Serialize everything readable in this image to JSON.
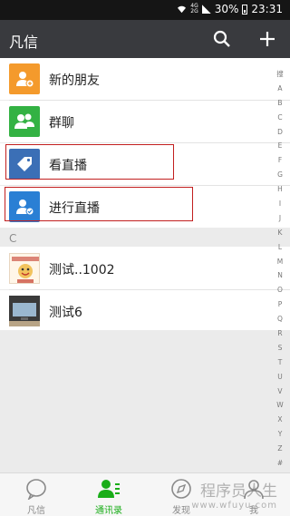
{
  "status": {
    "signal_top": "4G",
    "signal_bottom": "2G",
    "battery": "30%",
    "time": "23:31"
  },
  "header": {
    "title": "凡信",
    "search_icon": "search-icon",
    "add_icon": "plus-icon"
  },
  "menu": [
    {
      "label": "新的朋友",
      "icon": "new-friend-icon",
      "color": "#f49a2c"
    },
    {
      "label": "群聊",
      "icon": "group-chat-icon",
      "color": "#33b243"
    },
    {
      "label": "看直播",
      "icon": "tag-icon",
      "color": "#3b6fb6"
    },
    {
      "label": "进行直播",
      "icon": "start-live-icon",
      "color": "#2a7fd4"
    }
  ],
  "section_letter": "C",
  "contacts": [
    {
      "name": "测试..1002"
    },
    {
      "name": "测试6"
    }
  ],
  "alphabet_index": [
    "搜",
    "A",
    "B",
    "C",
    "D",
    "E",
    "F",
    "G",
    "H",
    "I",
    "J",
    "K",
    "L",
    "M",
    "N",
    "O",
    "P",
    "Q",
    "R",
    "S",
    "T",
    "U",
    "V",
    "W",
    "X",
    "Y",
    "Z",
    "#"
  ],
  "tabs": [
    {
      "label": "凡信",
      "icon": "chat-bubble-icon",
      "active": false
    },
    {
      "label": "通讯录",
      "icon": "contacts-icon",
      "active": true
    },
    {
      "label": "发现",
      "icon": "compass-icon",
      "active": false
    },
    {
      "label": "我",
      "icon": "person-icon",
      "active": false
    }
  ],
  "watermark": {
    "line1": "程序员人生",
    "line2": "www.wfuyu.com"
  },
  "colors": {
    "header_bg": "#393a3e",
    "accent_green": "#1aad19",
    "highlight_border": "#c21f1f"
  }
}
